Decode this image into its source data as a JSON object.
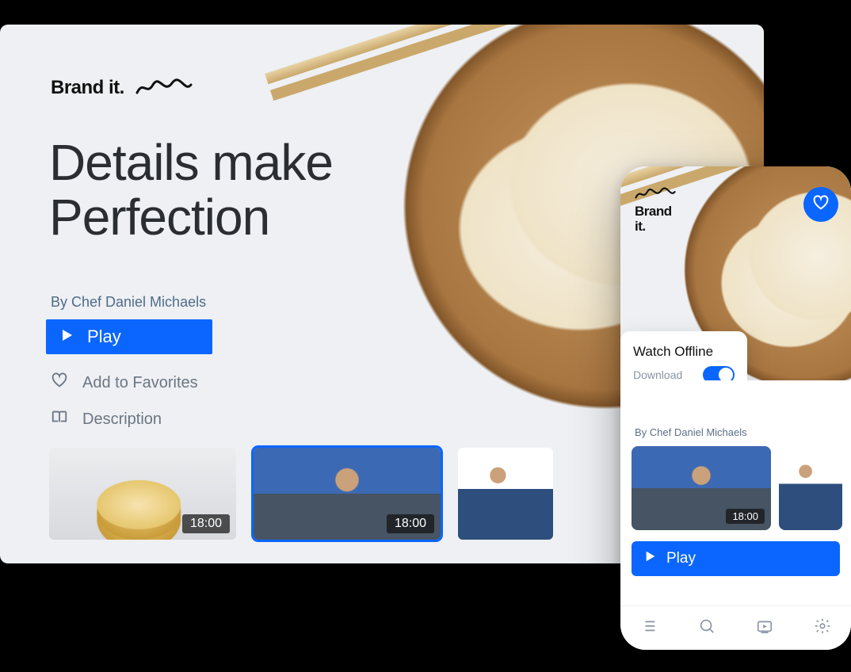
{
  "brand": {
    "label": "Brand it."
  },
  "tv": {
    "headline_l1": "Details make",
    "headline_l2": "Perfection",
    "byline": "By Chef Daniel Michaels",
    "play_label": "Play",
    "favorites_label": "Add to Favorites",
    "description_label": "Description",
    "thumbs": [
      {
        "duration": "18:00",
        "kind": "pancakes"
      },
      {
        "duration": "18:00",
        "kind": "chef",
        "selected": true
      },
      {
        "duration": "",
        "kind": "cook"
      }
    ]
  },
  "phone": {
    "offline_title": "Watch Offline",
    "offline_sub": "Download",
    "download_on": true,
    "byline": "By Chef Daniel Michaels",
    "play_label": "Play",
    "thumbs": [
      {
        "duration": "18:00",
        "kind": "chef"
      },
      {
        "duration": "",
        "kind": "cook"
      }
    ]
  },
  "colors": {
    "accent": "#0a66ff"
  }
}
